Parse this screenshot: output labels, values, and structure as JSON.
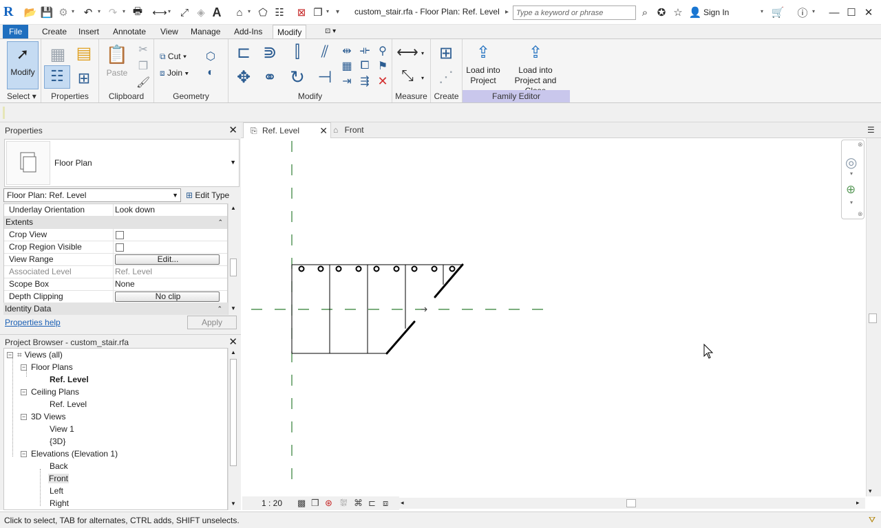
{
  "titlebar": {
    "app_logo": "R",
    "title": "custom_stair.rfa - Floor Plan: Ref. Level",
    "search_placeholder": "Type a keyword or phrase",
    "signin": "Sign In"
  },
  "ribbon_tabs": [
    "File",
    "Create",
    "Insert",
    "Annotate",
    "View",
    "Manage",
    "Add-Ins",
    "Modify"
  ],
  "active_tab": "Modify",
  "ribbon": {
    "select": {
      "button": "Modify",
      "label": "Select"
    },
    "properties": {
      "label": "Properties"
    },
    "clipboard": {
      "paste": "Paste",
      "label": "Clipboard"
    },
    "geometry": {
      "cut": "Cut",
      "join": "Join",
      "label": "Geometry"
    },
    "modify": {
      "label": "Modify"
    },
    "measure": {
      "label": "Measure"
    },
    "create": {
      "label": "Create"
    },
    "family_editor": {
      "load_project_line1": "Load into",
      "load_project_line2": "Project",
      "load_close_line1": "Load into",
      "load_close_line2": "Project and Close",
      "label": "Family Editor"
    }
  },
  "properties": {
    "title": "Properties",
    "type_name": "Floor Plan",
    "view_selector": "Floor Plan: Ref. Level",
    "edit_type": "Edit Type",
    "rows": {
      "underlay_k": "Underlay Orientation",
      "underlay_v": "Look down",
      "extents": "Extents",
      "crop_view": "Crop View",
      "crop_region": "Crop Region Visible",
      "view_range_k": "View Range",
      "view_range_v": "Edit...",
      "assoc_level_k": "Associated Level",
      "assoc_level_v": "Ref. Level",
      "scope_box_k": "Scope Box",
      "scope_box_v": "None",
      "depth_clip_k": "Depth Clipping",
      "depth_clip_v": "No clip"
    },
    "identity": "Identity Data",
    "help": "Properties help",
    "apply": "Apply"
  },
  "browser": {
    "title": "Project Browser - custom_stair.rfa",
    "nodes": {
      "views": "Views (all)",
      "floor_plans": "Floor Plans",
      "fp_ref": "Ref. Level",
      "ceiling_plans": "Ceiling Plans",
      "cp_ref": "Ref. Level",
      "views_3d": "3D Views",
      "view1": "View 1",
      "view3d": "{3D}",
      "elevations": "Elevations (Elevation 1)",
      "back": "Back",
      "front": "Front",
      "left": "Left",
      "right": "Right"
    }
  },
  "view_tabs": {
    "active": "Ref. Level",
    "other": "Front"
  },
  "view_control": {
    "scale": "1 : 20"
  },
  "status": "Click to select, TAB for alternates, CTRL adds, SHIFT unselects.",
  "colors": {
    "accent": "#1f6fbf",
    "family_editor_bg": "#c9c7ec",
    "ref_plane": "#2e7d32",
    "selected": "#c5dbf2"
  }
}
